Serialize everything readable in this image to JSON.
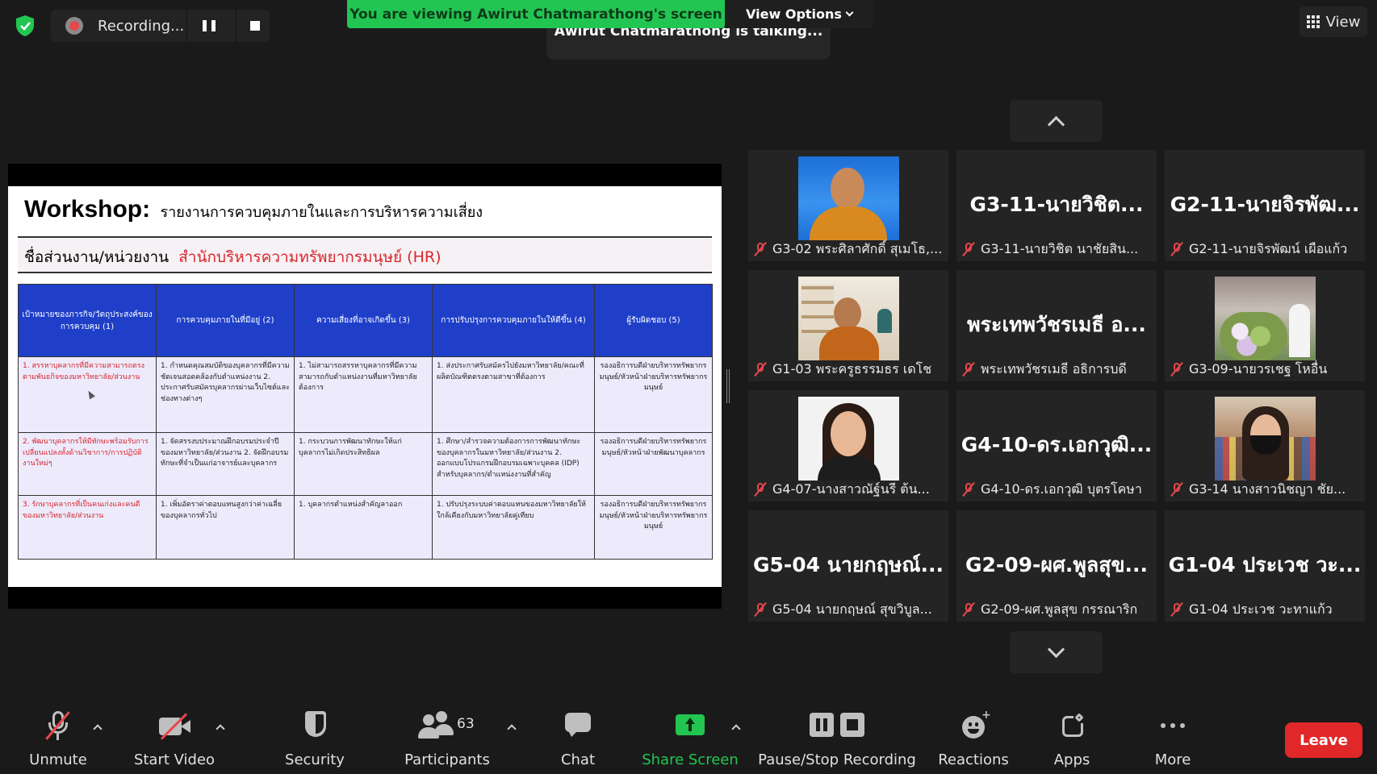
{
  "recording": {
    "label": "Recording..."
  },
  "banner": {
    "viewing": "You are viewing Awirut Chatmarathong's screen",
    "view_options": "View Options",
    "talking": "Awirut Chatmarathong is talking..."
  },
  "view_button": {
    "label": "View"
  },
  "slide": {
    "title": "Workshop:",
    "subtitle": "รายงานการควบคุมภายในและการบริหารความเสี่ยง",
    "dept_label": "ชื่อส่วนงาน/หน่วยงาน",
    "dept_value": "สำนักบริหารความทรัพยากรมนุษย์ (HR)",
    "headers": [
      "เป้าหมายของภารกิจ/วัตถุประสงค์ของการควบคุม (1)",
      "การควบคุมภายในที่มีอยู่ (2)",
      "ความเสี่ยงที่อาจเกิดขึ้น (3)",
      "การปรับปรุงการควบคุมภายในให้ดีขึ้น (4)",
      "ผู้รับผิดชอบ (5)"
    ],
    "rows": [
      [
        "1. สรรหาบุคลากรที่มีความสามารถตรงตามพันธกิจของมหาวิทยาลัย/ส่วนงาน",
        "1. กำหนดคุณสมบัติของบุคลากรที่มีความชัดเจนสอดคล้องกับตำแหน่งงาน 2. ประกาศรับสมัครบุคลากรผ่านเว็บไซต์และช่องทางต่างๆ",
        "1. ไม่สามารถสรรหาบุคลากรที่มีความสามารถกับตำแหน่งงานที่มหาวิทยาลัยต้องการ",
        "1. ส่งประกาศรับสมัครไปยังมหาวิทยาลัย/คณะที่ผลิตบัณฑิตตรงตามสาขาที่ต้องการ",
        "รองอธิการบดีฝ่ายบริหารทรัพยากรมนุษย์/หัวหน้าฝ่ายบริหารทรัพยากรมนุษย์"
      ],
      [
        "2. พัฒนาบุคลากรให้มีทักษะพร้อมรับการเปลี่ยนแปลงทั้งด้านวิชาการ/การปฏิบัติงานใหม่ๆ",
        "1. จัดสรรงบประมาณฝึกอบรมประจำปีของมหาวิทยาลัย/ส่วนงาน 2. จัดฝึกอบรมทักษะที่จำเป็นแก่อาจารย์และบุคลากร",
        "1. กระบวนการพัฒนาทักษะให้แก่บุคลากรไม่เกิดประสิทธิผล",
        "1. ศึกษา/สำรวจความต้องการการพัฒนาทักษะของบุคลากรในมหาวิทยาลัย/ส่วนงาน 2. ออกแบบโปรแกรมฝึกอบรมเฉพาะบุคคล (IDP) สำหรับบุคลากร/ตำแหน่งงานที่สำคัญ",
        "รองอธิการบดีฝ่ายบริหารทรัพยากรมนุษย์/หัวหน้าฝ่ายพัฒนาบุคลากร"
      ],
      [
        "3. รักษาบุคลากรที่เป็นคนเก่งและคนดีของมหาวิทยาลัย/ส่วนงาน",
        "1. เพิ่มอัตราค่าตอบแทนสูงกว่าค่าเฉลี่ยของบุคลากรทั่วไป",
        "1. บุคลากรตำแหน่งสำคัญลาออก",
        "1. ปรับปรุงระบบค่าตอบแทนของมหาวิทยาลัยให้ใกล้เคียงกับมหาวิทยาลัยคู่เทียบ",
        "รองอธิการบดีฝ่ายบริหารทรัพยากรมนุษย์/หัวหน้าฝ่ายบริหารทรัพยากรมนุษย์"
      ]
    ]
  },
  "participants": [
    {
      "display": "",
      "label": "G3-02 พระศิลาศักดิ์ สุเมโธ,...",
      "avatar": "monk1"
    },
    {
      "display": "G3-11-นายวิชิต...",
      "label": "G3-11-นายวิชิต นาชัยสิน...",
      "avatar": ""
    },
    {
      "display": "G2-11-นายจิรพัฒ...",
      "label": "G2-11-นายจิรพัฒน์ เผือแก้ว",
      "avatar": ""
    },
    {
      "display": "",
      "label": "G1-03 พระครูธรรมธร เดโช",
      "avatar": "monk2"
    },
    {
      "display": "พระเทพวัชรเมธี อ...",
      "label": "พระเทพวัชรเมธี อธิการบดี",
      "avatar": ""
    },
    {
      "display": "",
      "label": "G3-09-นายวรเชฐ โหอื่น",
      "avatar": "flowers"
    },
    {
      "display": "",
      "label": "G4-07-นางสาวณัฐ์นรี ต้น...",
      "avatar": "woman1"
    },
    {
      "display": "G4-10-ดร.เอกวุฒิ...",
      "label": "G4-10-ดร.เอกวุฒิ บุตรโคษา",
      "avatar": ""
    },
    {
      "display": "",
      "label": "G3-14 นางสาวนิชญา ชัย...",
      "avatar": "woman2"
    },
    {
      "display": "G5-04 นายกฤษณ์...",
      "label": "G5-04 นายกฤษณ์ สุขวิบูล...",
      "avatar": ""
    },
    {
      "display": "G2-09-ผศ.พูลสุข...",
      "label": "G2-09-ผศ.พูลสุข กรรณาริก",
      "avatar": ""
    },
    {
      "display": "G1-04 ประเวช วะ...",
      "label": "G1-04 ประเวช วะทาแก้ว",
      "avatar": ""
    }
  ],
  "toolbar": {
    "unmute": "Unmute",
    "start_video": "Start Video",
    "security": "Security",
    "participants": "Participants",
    "participants_count": "63",
    "chat": "Chat",
    "share_screen": "Share Screen",
    "pause_stop": "Pause/Stop Recording",
    "reactions": "Reactions",
    "apps": "Apps",
    "more": "More",
    "leave": "Leave"
  },
  "colors": {
    "accent_green": "#23c552",
    "leave_red": "#e02828",
    "mute_red": "#e5484d",
    "slide_header_blue": "#1f3fc9"
  }
}
